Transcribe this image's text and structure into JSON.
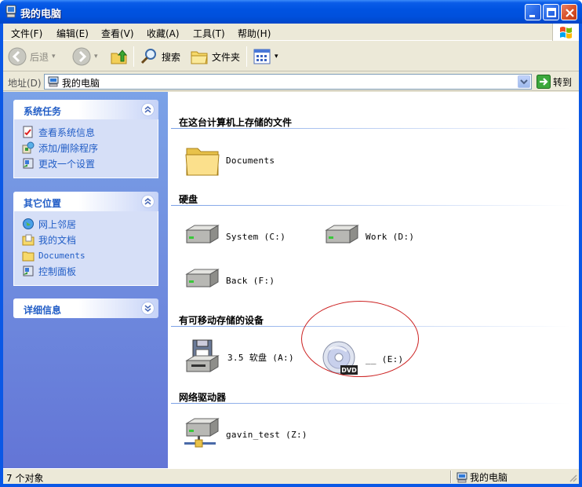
{
  "window": {
    "title": "我的电脑"
  },
  "menu": [
    "文件(F)",
    "编辑(E)",
    "查看(V)",
    "收藏(A)",
    "工具(T)",
    "帮助(H)"
  ],
  "toolbar": {
    "back": "后退",
    "search": "搜索",
    "folders": "文件夹"
  },
  "address": {
    "label": "地址(D)",
    "value": "我的电脑",
    "go": "转到"
  },
  "taskpane": {
    "system_tasks": {
      "title": "系统任务",
      "items": [
        "查看系统信息",
        "添加/删除程序",
        "更改一个设置"
      ]
    },
    "other_places": {
      "title": "其它位置",
      "items": [
        "网上邻居",
        "我的文档",
        "Documents",
        "控制面板"
      ]
    },
    "details": {
      "title": "详细信息"
    }
  },
  "sections": {
    "stored": {
      "title": "在这台计算机上存储的文件",
      "items": [
        "Documents"
      ]
    },
    "harddisks": {
      "title": "硬盘",
      "items": [
        "System (C:)",
        "Work (D:)",
        "Back (F:)"
      ]
    },
    "removable": {
      "title": "有可移动存储的设备",
      "items": [
        "3.5 软盘 (A:)",
        "__ (E:)"
      ]
    },
    "network": {
      "title": "网络驱动器",
      "items": [
        "gavin_test (Z:)"
      ]
    }
  },
  "status": {
    "count": "7 个对象",
    "location": "我的电脑"
  },
  "colors": {
    "titlebar": "#0054e3",
    "taskpane": "#7ba2e7",
    "link": "#215dc6",
    "annotation": "#cc2222"
  }
}
